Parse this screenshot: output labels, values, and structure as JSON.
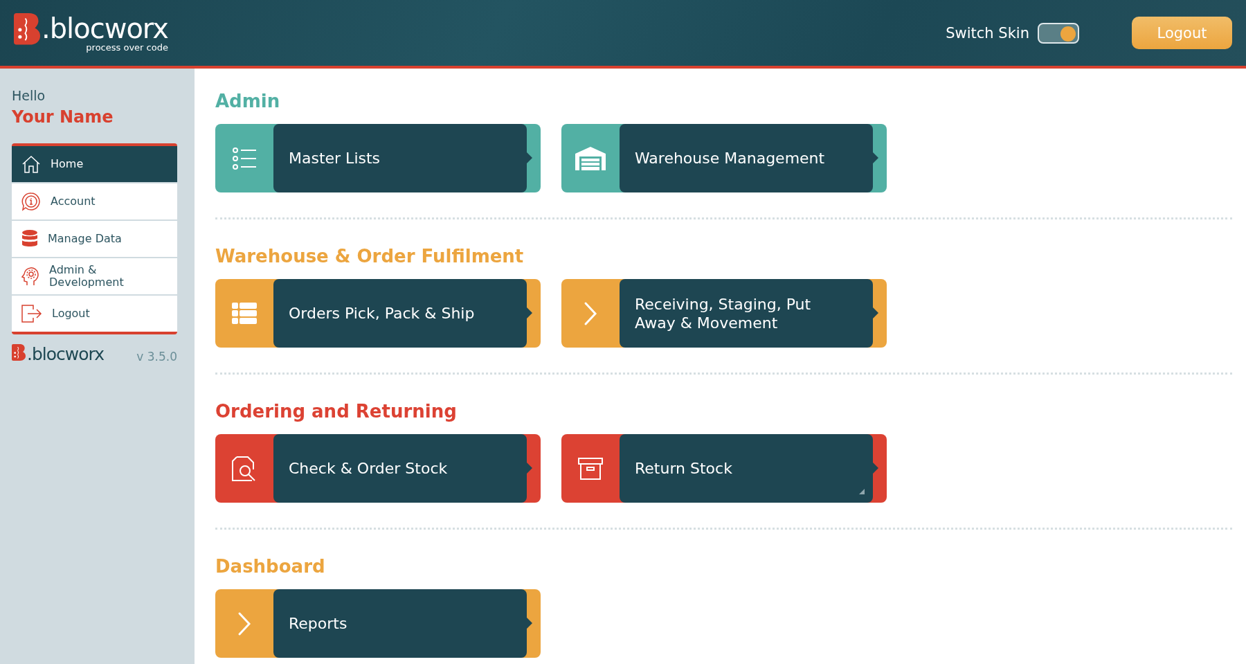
{
  "header": {
    "logo": {
      "wordmark": ".blocworx",
      "tagline": "process over code"
    },
    "switch_skin": {
      "label": "Switch Skin",
      "on": true
    },
    "logout_button": "Logout"
  },
  "sidebar": {
    "greeting": "Hello",
    "user_name": "Your Name",
    "items": [
      {
        "label": "Home",
        "selected": true
      },
      {
        "label": "Account",
        "selected": false
      },
      {
        "label": "Manage Data",
        "selected": false
      },
      {
        "label": "Admin & Development",
        "selected": false
      },
      {
        "label": "Logout",
        "selected": false
      }
    ],
    "footer": {
      "wordmark": ".blocworx",
      "version": "v 3.5.0"
    }
  },
  "sections": [
    {
      "title": "Admin",
      "color": "#52b0a4",
      "tiles": [
        {
          "label": "Master Lists"
        },
        {
          "label": "Warehouse Management"
        }
      ]
    },
    {
      "title": "Warehouse & Order Fulfilment",
      "color": "#eca53f",
      "tiles": [
        {
          "label": "Orders Pick, Pack & Ship"
        },
        {
          "label": "Receiving, Staging, Put Away & Movement"
        }
      ]
    },
    {
      "title": "Ordering and Returning",
      "color": "#dc4233",
      "tiles": [
        {
          "label": "Check & Order Stock"
        },
        {
          "label": "Return Stock",
          "resize_handle": true
        }
      ]
    },
    {
      "title": "Dashboard",
      "color": "#eca53f",
      "tiles": [
        {
          "label": "Reports"
        }
      ]
    }
  ]
}
